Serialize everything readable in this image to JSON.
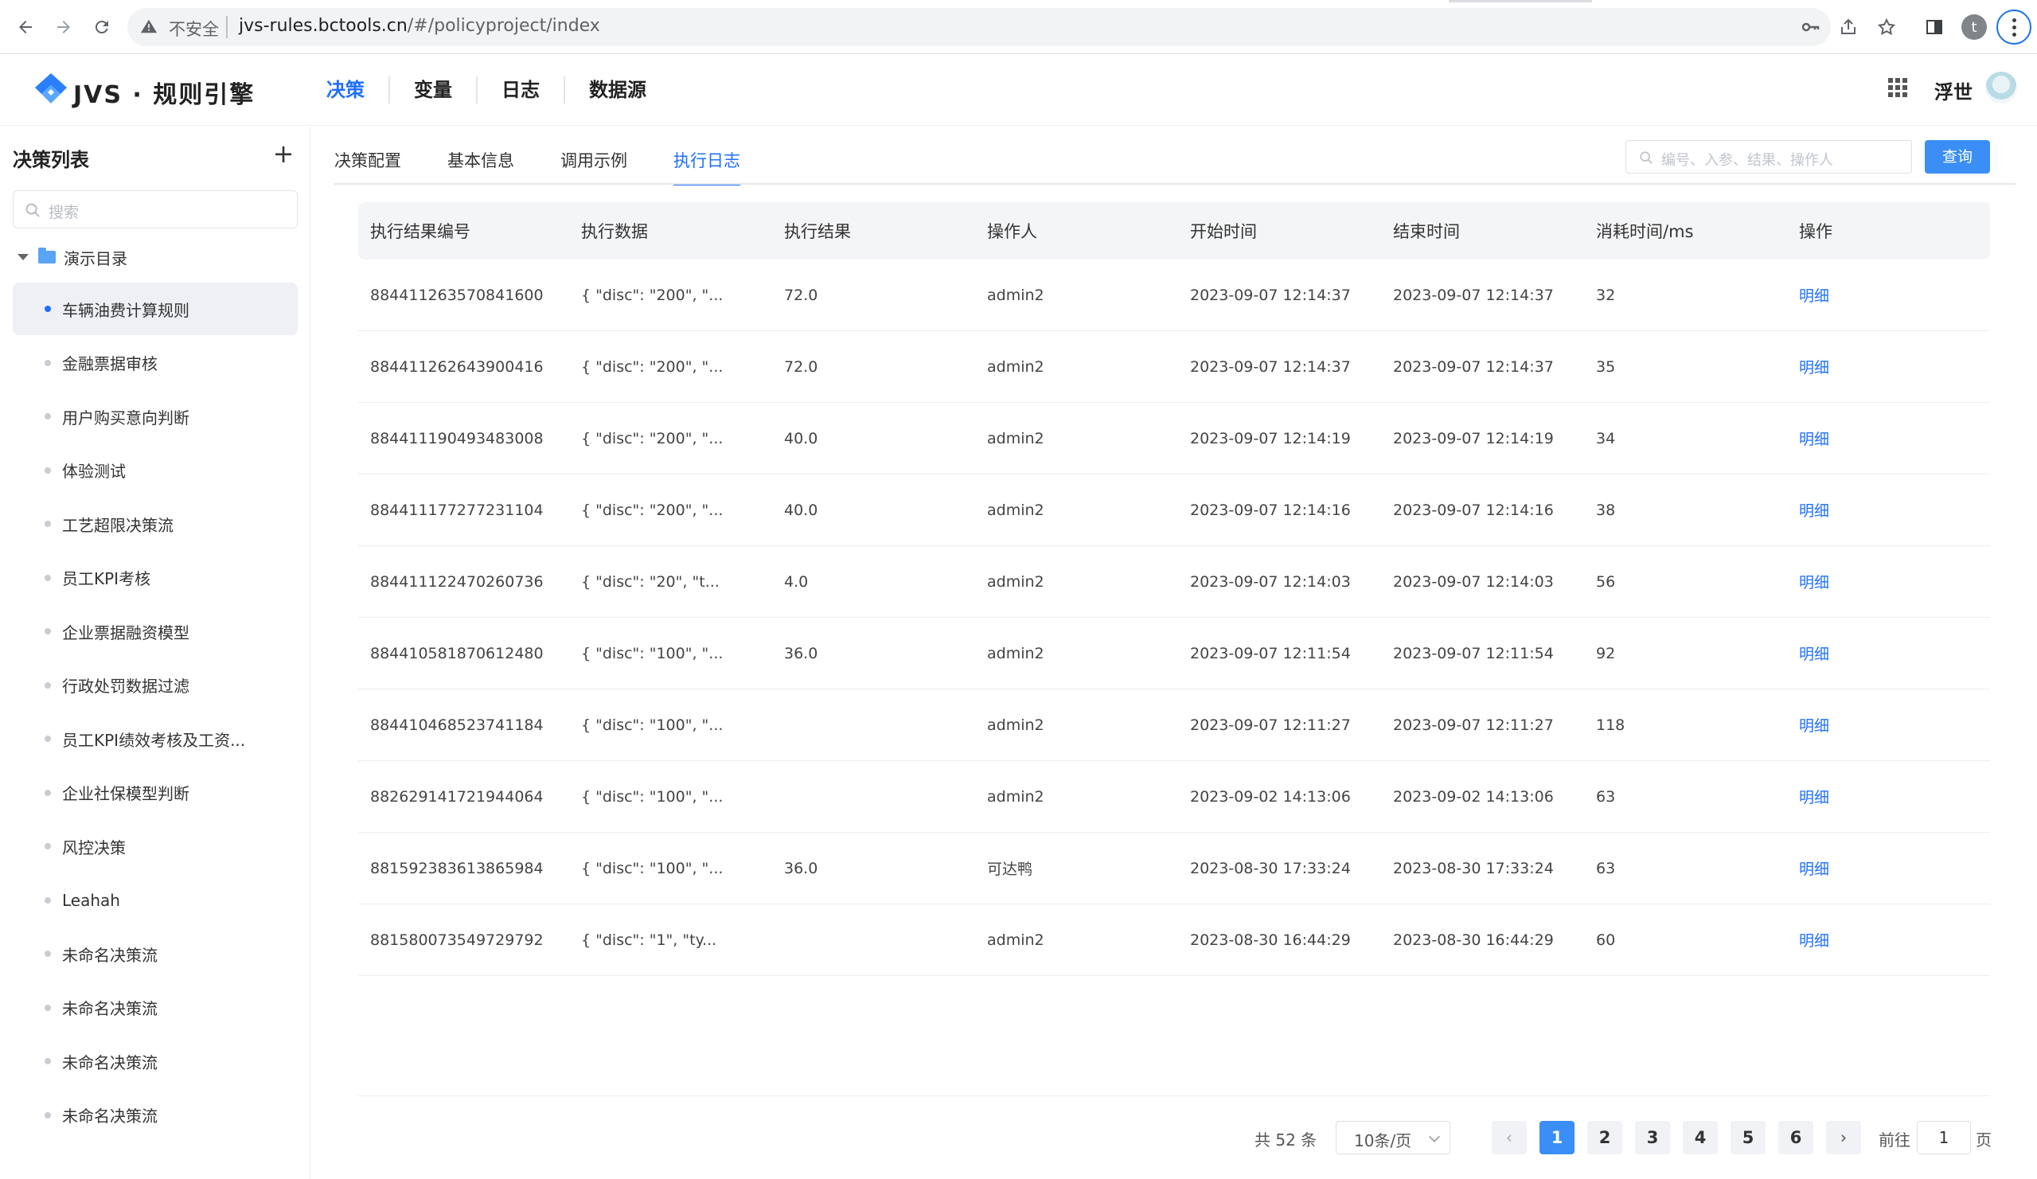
{
  "browser": {
    "insecure_label": "不安全",
    "url_host": "jvs-rules.bctools.cn",
    "url_path": "/#/policyproject/index",
    "profile_initial": "t",
    "icons": [
      "back-icon",
      "forward-icon",
      "reload-icon",
      "warning-icon",
      "key-icon",
      "share-icon",
      "star-icon",
      "sidepanel-icon",
      "menu-icon"
    ]
  },
  "app": {
    "brand": "JVS · 规则引擎",
    "nav": [
      {
        "label": "决策",
        "active": true
      },
      {
        "label": "变量",
        "active": false
      },
      {
        "label": "日志",
        "active": false
      },
      {
        "label": "数据源",
        "active": false
      }
    ],
    "user_name": "浮世",
    "accent_color": "#1e6fff"
  },
  "sidebar": {
    "title": "决策列表",
    "add_label": "+",
    "search_placeholder": "搜索",
    "root_folder": "演示目录",
    "items": [
      {
        "label": "车辆油费计算规则",
        "active": true
      },
      {
        "label": "金融票据审核",
        "active": false
      },
      {
        "label": "用户购买意向判断",
        "active": false
      },
      {
        "label": "体验测试",
        "active": false
      },
      {
        "label": "工艺超限决策流",
        "active": false
      },
      {
        "label": "员工KPI考核",
        "active": false
      },
      {
        "label": "企业票据融资模型",
        "active": false
      },
      {
        "label": "行政处罚数据过滤",
        "active": false
      },
      {
        "label": "员工KPI绩效考核及工资...",
        "active": false
      },
      {
        "label": "企业社保模型判断",
        "active": false
      },
      {
        "label": "风控决策",
        "active": false
      },
      {
        "label": "Leahah",
        "active": false
      },
      {
        "label": "未命名决策流",
        "active": false
      },
      {
        "label": "未命名决策流",
        "active": false
      },
      {
        "label": "未命名决策流",
        "active": false
      },
      {
        "label": "未命名决策流",
        "active": false
      }
    ]
  },
  "main": {
    "tabs": [
      {
        "label": "决策配置",
        "active": false
      },
      {
        "label": "基本信息",
        "active": false
      },
      {
        "label": "调用示例",
        "active": false
      },
      {
        "label": "执行日志",
        "active": true
      }
    ],
    "search_placeholder": "编号、入参、结果、操作人",
    "query_label": "查询",
    "columns": [
      "执行结果编号",
      "执行数据",
      "执行结果",
      "操作人",
      "开始时间",
      "结束时间",
      "消耗时间/ms",
      "操作"
    ],
    "rows": [
      {
        "id": "884411263570841600",
        "data": "{ \"disc\": \"200\", \"...",
        "result": "72.0",
        "operator": "admin2",
        "start": "2023-09-07 12:14:37",
        "end": "2023-09-07 12:14:37",
        "cost": "32",
        "action": "明细"
      },
      {
        "id": "884411262643900416",
        "data": "{ \"disc\": \"200\", \"...",
        "result": "72.0",
        "operator": "admin2",
        "start": "2023-09-07 12:14:37",
        "end": "2023-09-07 12:14:37",
        "cost": "35",
        "action": "明细"
      },
      {
        "id": "884411190493483008",
        "data": "{ \"disc\": \"200\", \"...",
        "result": "40.0",
        "operator": "admin2",
        "start": "2023-09-07 12:14:19",
        "end": "2023-09-07 12:14:19",
        "cost": "34",
        "action": "明细"
      },
      {
        "id": "884411177277231104",
        "data": "{ \"disc\": \"200\", \"...",
        "result": "40.0",
        "operator": "admin2",
        "start": "2023-09-07 12:14:16",
        "end": "2023-09-07 12:14:16",
        "cost": "38",
        "action": "明细"
      },
      {
        "id": "884411122470260736",
        "data": "{ \"disc\": \"20\", \"t...",
        "result": "4.0",
        "operator": "admin2",
        "start": "2023-09-07 12:14:03",
        "end": "2023-09-07 12:14:03",
        "cost": "56",
        "action": "明细"
      },
      {
        "id": "884410581870612480",
        "data": "{ \"disc\": \"100\", \"...",
        "result": "36.0",
        "operator": "admin2",
        "start": "2023-09-07 12:11:54",
        "end": "2023-09-07 12:11:54",
        "cost": "92",
        "action": "明细"
      },
      {
        "id": "884410468523741184",
        "data": "{ \"disc\": \"100\", \"...",
        "result": "",
        "operator": "admin2",
        "start": "2023-09-07 12:11:27",
        "end": "2023-09-07 12:11:27",
        "cost": "118",
        "action": "明细"
      },
      {
        "id": "882629141721944064",
        "data": "{ \"disc\": \"100\", \"...",
        "result": "",
        "operator": "admin2",
        "start": "2023-09-02 14:13:06",
        "end": "2023-09-02 14:13:06",
        "cost": "63",
        "action": "明细"
      },
      {
        "id": "881592383613865984",
        "data": "{ \"disc\": \"100\", \"...",
        "result": "36.0",
        "operator": "可达鸭",
        "start": "2023-08-30 17:33:24",
        "end": "2023-08-30 17:33:24",
        "cost": "63",
        "action": "明细"
      },
      {
        "id": "881580073549729792",
        "data": "{ \"disc\": \"1\", \"ty...",
        "result": "",
        "operator": "admin2",
        "start": "2023-08-30 16:44:29",
        "end": "2023-08-30 16:44:29",
        "cost": "60",
        "action": "明细"
      }
    ]
  },
  "pagination": {
    "total_label": "共 52 条",
    "page_size": "10条/页",
    "prev": "‹",
    "next": "›",
    "pages": [
      "1",
      "2",
      "3",
      "4",
      "5",
      "6"
    ],
    "current": "1",
    "goto_prefix": "前往",
    "goto_value": "1",
    "goto_suffix": "页"
  }
}
